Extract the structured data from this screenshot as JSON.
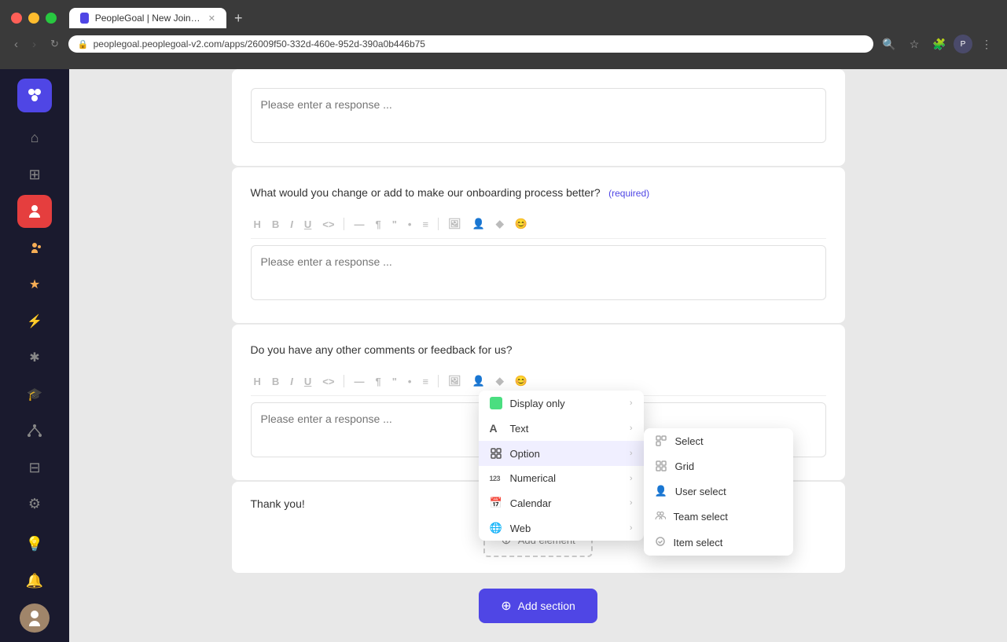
{
  "browser": {
    "tab_title": "PeopleGoal | New Joiner Surve...",
    "url": "peoplegoal.peoplegoal-v2.com/apps/26009f50-332d-460e-952d-390a0b446b75",
    "new_tab_label": "+"
  },
  "sidebar": {
    "logo_alt": "PeopleGoal logo",
    "items": [
      {
        "id": "home",
        "icon": "⌂",
        "label": "Home"
      },
      {
        "id": "apps",
        "icon": "⊞",
        "label": "Apps"
      },
      {
        "id": "recruit",
        "icon": "👤",
        "label": "Recruit",
        "active": true
      },
      {
        "id": "users",
        "icon": "👥",
        "label": "Users"
      },
      {
        "id": "goals",
        "icon": "★",
        "label": "Goals"
      },
      {
        "id": "lightning",
        "icon": "⚡",
        "label": "Lightning"
      },
      {
        "id": "asterisk",
        "icon": "✱",
        "label": "Asterisk"
      },
      {
        "id": "learn",
        "icon": "🎓",
        "label": "Learn"
      },
      {
        "id": "tree",
        "icon": "⋮",
        "label": "Tree"
      },
      {
        "id": "grid2",
        "icon": "⊟",
        "label": "Grid"
      },
      {
        "id": "settings",
        "icon": "⚙",
        "label": "Settings"
      },
      {
        "id": "idea",
        "icon": "💡",
        "label": "Idea"
      },
      {
        "id": "bell",
        "icon": "🔔",
        "label": "Notifications"
      }
    ]
  },
  "questions": [
    {
      "id": "q1",
      "placeholder": "Please enter a response ..."
    },
    {
      "id": "q2",
      "label": "What would you change or add to make our onboarding process better?",
      "required": true,
      "required_label": "(required)",
      "placeholder": "Please enter a response ..."
    },
    {
      "id": "q3",
      "label": "Do you have any other comments or feedback for us?",
      "required": false,
      "placeholder": "Please enter a response ..."
    }
  ],
  "thank_you_text": "Thank you!",
  "add_element_label": "Add element",
  "add_section_label": "Add section",
  "toolbar": {
    "buttons": [
      "H",
      "B",
      "I",
      "U",
      "<>",
      "—",
      "¶",
      "\"",
      "•",
      "≡",
      "🖼",
      "👤",
      "◆",
      "😊"
    ]
  },
  "dropdown_menu": {
    "items": [
      {
        "id": "display-only",
        "label": "Display only",
        "icon": "display",
        "has_submenu": true
      },
      {
        "id": "text",
        "label": "Text",
        "icon": "A",
        "has_submenu": true
      },
      {
        "id": "option",
        "label": "Option",
        "icon": "option",
        "has_submenu": true,
        "active": true
      },
      {
        "id": "numerical",
        "label": "Numerical",
        "icon": "123",
        "has_submenu": true
      },
      {
        "id": "calendar",
        "label": "Calendar",
        "icon": "cal",
        "has_submenu": true
      },
      {
        "id": "web",
        "label": "Web",
        "icon": "web",
        "has_submenu": true
      }
    ],
    "submenu": {
      "parent": "option",
      "items": [
        {
          "id": "select",
          "label": "Select",
          "icon": "grid"
        },
        {
          "id": "grid",
          "label": "Grid",
          "icon": "grid"
        },
        {
          "id": "user-select",
          "label": "User select",
          "icon": "user"
        },
        {
          "id": "team-select",
          "label": "Team select",
          "icon": "team"
        },
        {
          "id": "item-select",
          "label": "Item select",
          "icon": "item"
        }
      ]
    }
  }
}
